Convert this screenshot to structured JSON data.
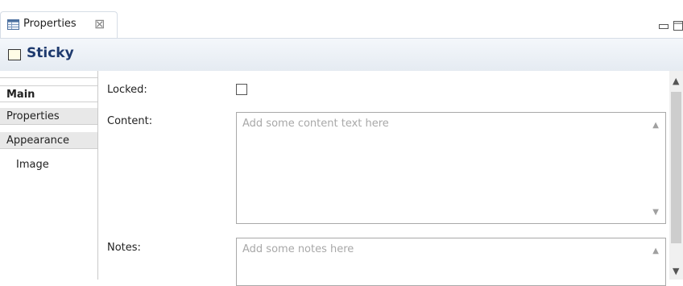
{
  "view": {
    "tab_label": "Properties",
    "close_glyph": "⊠",
    "tab_icon": "properties-table-icon",
    "minimize_icon": "minimize-icon",
    "maximize_icon": "maximize-icon"
  },
  "header": {
    "title": "Sticky",
    "icon": "sticky-icon"
  },
  "sidebar": {
    "tabs": [
      {
        "label": "Main",
        "active": true
      },
      {
        "label": "Properties",
        "active": false
      },
      {
        "label": "Appearance",
        "active": false
      },
      {
        "label": "Image",
        "active": false
      }
    ]
  },
  "form": {
    "locked_label": "Locked:",
    "locked_checked": false,
    "content_label": "Content:",
    "content_placeholder": "Add some content text here",
    "notes_label": "Notes:",
    "notes_placeholder": "Add some notes here"
  },
  "colors": {
    "title_text": "#1e3a6e",
    "sidebar_tab_bg": "#e8e8e8"
  }
}
